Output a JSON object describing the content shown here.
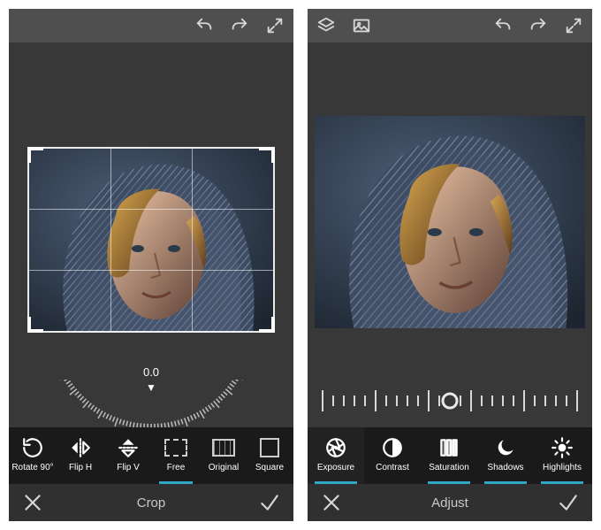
{
  "left": {
    "mode_title": "Crop",
    "rotation_value": "0.0",
    "tools": {
      "rotate90": "Rotate 90°",
      "fliph": "Flip H",
      "flipv": "Flip V",
      "free": "Free",
      "original": "Original",
      "square": "Square"
    }
  },
  "right": {
    "mode_title": "Adjust",
    "slider_value": 0,
    "tools": {
      "exposure": "Exposure",
      "contrast": "Contrast",
      "saturation": "Saturation",
      "shadows": "Shadows",
      "highlights": "Highlights"
    }
  }
}
